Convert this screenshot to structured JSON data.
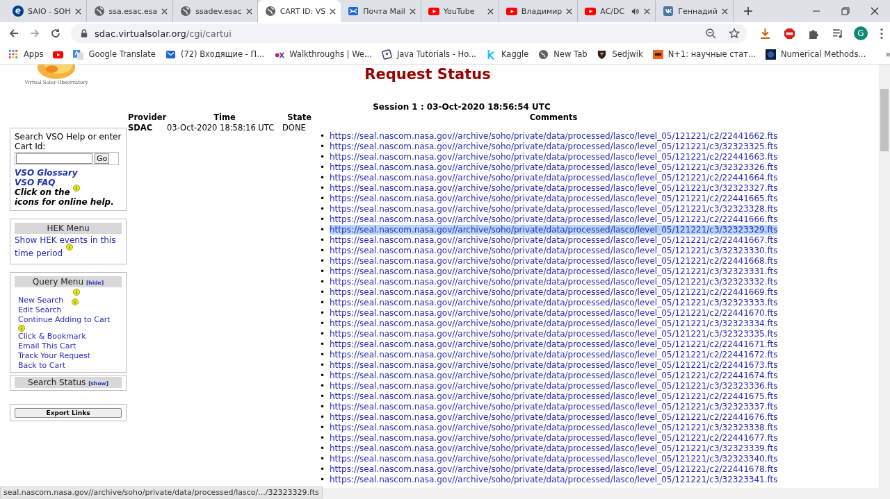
{
  "browser": {
    "tabs": [
      {
        "title": "SAIO - SOH",
        "kind": "esa",
        "selected": false,
        "audio": false
      },
      {
        "title": "ssa.esac.esa",
        "kind": "globe",
        "selected": false,
        "audio": false
      },
      {
        "title": "ssadev.esac",
        "kind": "globe",
        "selected": false,
        "audio": false
      },
      {
        "title": "CART ID: VS",
        "kind": "globe",
        "selected": true,
        "audio": false
      },
      {
        "title": "Почта Mail",
        "kind": "mail",
        "selected": false,
        "audio": false
      },
      {
        "title": "YouTube",
        "kind": "youtube",
        "selected": false,
        "audio": false
      },
      {
        "title": "Владимир",
        "kind": "youtube",
        "selected": false,
        "audio": false
      },
      {
        "title": "AC/DC",
        "kind": "youtube",
        "selected": false,
        "audio": true
      },
      {
        "title": "Геннадий",
        "kind": "vk",
        "selected": false,
        "audio": false
      }
    ],
    "address": {
      "host": "sdac.virtualsolar.org",
      "path": "/cgi/cartui"
    },
    "profile_initial": "G",
    "bookmarks": [
      {
        "label": "Apps",
        "kind": "apps"
      },
      {
        "kind": "youtube"
      },
      {
        "label": "Google Translate",
        "kind": "translate"
      },
      {
        "label": "(72) Входящие - П...",
        "kind": "mail"
      },
      {
        "label": "Walkthroughs | We...",
        "kind": "edx"
      },
      {
        "label": "Java Tutorials - Ho...",
        "kind": "java"
      },
      {
        "label": "Kaggle",
        "kind": "kaggle"
      },
      {
        "label": "New Tab",
        "kind": "globe"
      },
      {
        "label": "Sedjwik",
        "kind": "shield"
      },
      {
        "label": "N+1: научные стат...",
        "kind": "n1"
      },
      {
        "label": "Numerical Methods...",
        "kind": "square"
      }
    ],
    "bookmarks_more": "»",
    "status_tooltip": "seal.nascom.nasa.gov//archive/soho/private/data/processed/lasco/.../32323329.fts"
  },
  "page": {
    "logo_caption": "Virtual Solar Observatory",
    "heading": "Request Status",
    "help_box": {
      "prompt": "Search VSO Help or enter Cart Id:",
      "go": "Go",
      "links": [
        "VSO Glossary",
        "VSO FAQ"
      ],
      "hint_before": "Click on the",
      "hint_after": "icons for online help."
    },
    "hek_menu": {
      "title": "HEK Menu",
      "link": "Show HEK events in this time period"
    },
    "query_menu": {
      "title": "Query Menu",
      "toggle": "[hide]",
      "items": [
        "New Search",
        "Edit Search",
        "Continue Adding to Cart",
        "Click & Bookmark",
        "Email This Cart",
        "Track Your Request",
        "Back to Cart"
      ]
    },
    "search_status": {
      "title": "Search Status",
      "toggle": "[show]"
    },
    "export_button": "Export Links",
    "session": "Session 1 : 03-Oct-2020 18:56:54 UTC",
    "table": {
      "columns": [
        "Provider",
        "Time",
        "State",
        "Comments"
      ],
      "rows": [
        {
          "provider": "SDAC",
          "time": "03-Oct-2020 18:58:16 UTC",
          "state": "DONE"
        }
      ]
    },
    "links": [
      {
        "marker": "•",
        "url": "https://seal.nascom.nasa.gov//archive/soho/private/data/processed/lasco/level_05/121221/c2/22441662.fts",
        "highlighted": false
      },
      {
        "marker": "•",
        "url": "https://seal.nascom.nasa.gov//archive/soho/private/data/processed/lasco/level_05/121221/c3/32323325.fts",
        "highlighted": false
      },
      {
        "marker": "•",
        "url": "https://seal.nascom.nasa.gov//archive/soho/private/data/processed/lasco/level_05/121221/c2/22441663.fts",
        "highlighted": false
      },
      {
        "marker": "•",
        "url": "https://seal.nascom.nasa.gov//archive/soho/private/data/processed/lasco/level_05/121221/c3/32323326.fts",
        "highlighted": false
      },
      {
        "marker": "•",
        "url": "https://seal.nascom.nasa.gov//archive/soho/private/data/processed/lasco/level_05/121221/c2/22441664.fts",
        "highlighted": false
      },
      {
        "marker": "•",
        "url": "https://seal.nascom.nasa.gov//archive/soho/private/data/processed/lasco/level_05/121221/c3/32323327.fts",
        "highlighted": false
      },
      {
        "marker": "•",
        "url": "https://seal.nascom.nasa.gov//archive/soho/private/data/processed/lasco/level_05/121221/c2/22441665.fts",
        "highlighted": false
      },
      {
        "marker": "•",
        "url": "https://seal.nascom.nasa.gov//archive/soho/private/data/processed/lasco/level_05/121221/c3/32323328.fts",
        "highlighted": false
      },
      {
        "marker": "•",
        "url": "https://seal.nascom.nasa.gov//archive/soho/private/data/processed/lasco/level_05/121221/c2/22441666.fts",
        "highlighted": false
      },
      {
        "marker": "•",
        "url": "https://seal.nascom.nasa.gov//archive/soho/private/data/processed/lasco/level_05/121221/c3/32323329.fts",
        "highlighted": true
      },
      {
        "marker": "•",
        "url": "https://seal.nascom.nasa.gov//archive/soho/private/data/processed/lasco/level_05/121221/c2/22441667.fts",
        "highlighted": false
      },
      {
        "marker": "•",
        "url": "https://seal.nascom.nasa.gov//archive/soho/private/data/processed/lasco/level_05/121221/c3/32323330.fts",
        "highlighted": false
      },
      {
        "marker": "•",
        "url": "https://seal.nascom.nasa.gov//archive/soho/private/data/processed/lasco/level_05/121221/c2/22441668.fts",
        "highlighted": false
      },
      {
        "marker": "•",
        "url": "https://seal.nascom.nasa.gov//archive/soho/private/data/processed/lasco/level_05/121221/c3/32323331.fts",
        "highlighted": false
      },
      {
        "marker": "•",
        "url": "https://seal.nascom.nasa.gov//archive/soho/private/data/processed/lasco/level_05/121221/c3/32323332.fts",
        "highlighted": false
      },
      {
        "marker": "•",
        "url": "https://seal.nascom.nasa.gov//archive/soho/private/data/processed/lasco/level_05/121221/c2/22441669.fts",
        "highlighted": false
      },
      {
        "marker": "•",
        "url": "https://seal.nascom.nasa.gov//archive/soho/private/data/processed/lasco/level_05/121221/c3/32323333.fts",
        "highlighted": false
      },
      {
        "marker": "•",
        "url": "https://seal.nascom.nasa.gov//archive/soho/private/data/processed/lasco/level_05/121221/c2/22441670.fts",
        "highlighted": false
      },
      {
        "marker": "•",
        "url": "https://seal.nascom.nasa.gov//archive/soho/private/data/processed/lasco/level_05/121221/c3/32323334.fts",
        "highlighted": false
      },
      {
        "marker": "•",
        "url": "https://seal.nascom.nasa.gov//archive/soho/private/data/processed/lasco/level_05/121221/c3/32323335.fts",
        "highlighted": false
      },
      {
        "marker": "•",
        "url": "https://seal.nascom.nasa.gov//archive/soho/private/data/processed/lasco/level_05/121221/c2/22441671.fts",
        "highlighted": false
      },
      {
        "marker": "•",
        "url": "https://seal.nascom.nasa.gov//archive/soho/private/data/processed/lasco/level_05/121221/c2/22441672.fts",
        "highlighted": false
      },
      {
        "marker": "•",
        "url": "https://seal.nascom.nasa.gov//archive/soho/private/data/processed/lasco/level_05/121221/c2/22441673.fts",
        "highlighted": false
      },
      {
        "marker": "•",
        "url": "https://seal.nascom.nasa.gov//archive/soho/private/data/processed/lasco/level_05/121221/c2/22441674.fts",
        "highlighted": false
      },
      {
        "marker": "•",
        "url": "https://seal.nascom.nasa.gov//archive/soho/private/data/processed/lasco/level_05/121221/c3/32323336.fts",
        "highlighted": false
      },
      {
        "marker": "•",
        "url": "https://seal.nascom.nasa.gov//archive/soho/private/data/processed/lasco/level_05/121221/c2/22441675.fts",
        "highlighted": false
      },
      {
        "marker": "•",
        "url": "https://seal.nascom.nasa.gov//archive/soho/private/data/processed/lasco/level_05/121221/c3/32323337.fts",
        "highlighted": false
      },
      {
        "marker": "•",
        "url": "https://seal.nascom.nasa.gov//archive/soho/private/data/processed/lasco/level_05/121221/c2/22441676.fts",
        "highlighted": false
      },
      {
        "marker": "•",
        "url": "https://seal.nascom.nasa.gov//archive/soho/private/data/processed/lasco/level_05/121221/c3/32323338.fts",
        "highlighted": false
      },
      {
        "marker": "•",
        "url": "https://seal.nascom.nasa.gov//archive/soho/private/data/processed/lasco/level_05/121221/c2/22441677.fts",
        "highlighted": false
      },
      {
        "marker": "•",
        "url": "https://seal.nascom.nasa.gov//archive/soho/private/data/processed/lasco/level_05/121221/c3/32323339.fts",
        "highlighted": false
      },
      {
        "marker": "•",
        "url": "https://seal.nascom.nasa.gov//archive/soho/private/data/processed/lasco/level_05/121221/c3/32323340.fts",
        "highlighted": false
      },
      {
        "marker": "•",
        "url": "https://seal.nascom.nasa.gov//archive/soho/private/data/processed/lasco/level_05/121221/c2/22441678.fts",
        "highlighted": false
      },
      {
        "marker": "•",
        "url": "https://seal.nascom.nasa.gov//archive/soho/private/data/processed/lasco/level_05/121221/c3/32323341.fts",
        "highlighted": false
      }
    ]
  }
}
